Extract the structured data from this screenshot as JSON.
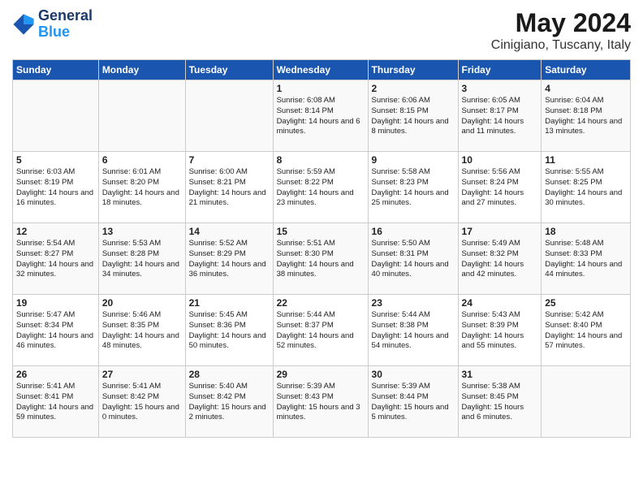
{
  "header": {
    "logo_line1": "General",
    "logo_line2": "Blue",
    "month": "May 2024",
    "location": "Cinigiano, Tuscany, Italy"
  },
  "columns": [
    "Sunday",
    "Monday",
    "Tuesday",
    "Wednesday",
    "Thursday",
    "Friday",
    "Saturday"
  ],
  "weeks": [
    [
      {
        "day": "",
        "sunrise": "",
        "sunset": "",
        "daylight": ""
      },
      {
        "day": "",
        "sunrise": "",
        "sunset": "",
        "daylight": ""
      },
      {
        "day": "",
        "sunrise": "",
        "sunset": "",
        "daylight": ""
      },
      {
        "day": "1",
        "sunrise": "Sunrise: 6:08 AM",
        "sunset": "Sunset: 8:14 PM",
        "daylight": "Daylight: 14 hours and 6 minutes."
      },
      {
        "day": "2",
        "sunrise": "Sunrise: 6:06 AM",
        "sunset": "Sunset: 8:15 PM",
        "daylight": "Daylight: 14 hours and 8 minutes."
      },
      {
        "day": "3",
        "sunrise": "Sunrise: 6:05 AM",
        "sunset": "Sunset: 8:17 PM",
        "daylight": "Daylight: 14 hours and 11 minutes."
      },
      {
        "day": "4",
        "sunrise": "Sunrise: 6:04 AM",
        "sunset": "Sunset: 8:18 PM",
        "daylight": "Daylight: 14 hours and 13 minutes."
      }
    ],
    [
      {
        "day": "5",
        "sunrise": "Sunrise: 6:03 AM",
        "sunset": "Sunset: 8:19 PM",
        "daylight": "Daylight: 14 hours and 16 minutes."
      },
      {
        "day": "6",
        "sunrise": "Sunrise: 6:01 AM",
        "sunset": "Sunset: 8:20 PM",
        "daylight": "Daylight: 14 hours and 18 minutes."
      },
      {
        "day": "7",
        "sunrise": "Sunrise: 6:00 AM",
        "sunset": "Sunset: 8:21 PM",
        "daylight": "Daylight: 14 hours and 21 minutes."
      },
      {
        "day": "8",
        "sunrise": "Sunrise: 5:59 AM",
        "sunset": "Sunset: 8:22 PM",
        "daylight": "Daylight: 14 hours and 23 minutes."
      },
      {
        "day": "9",
        "sunrise": "Sunrise: 5:58 AM",
        "sunset": "Sunset: 8:23 PM",
        "daylight": "Daylight: 14 hours and 25 minutes."
      },
      {
        "day": "10",
        "sunrise": "Sunrise: 5:56 AM",
        "sunset": "Sunset: 8:24 PM",
        "daylight": "Daylight: 14 hours and 27 minutes."
      },
      {
        "day": "11",
        "sunrise": "Sunrise: 5:55 AM",
        "sunset": "Sunset: 8:25 PM",
        "daylight": "Daylight: 14 hours and 30 minutes."
      }
    ],
    [
      {
        "day": "12",
        "sunrise": "Sunrise: 5:54 AM",
        "sunset": "Sunset: 8:27 PM",
        "daylight": "Daylight: 14 hours and 32 minutes."
      },
      {
        "day": "13",
        "sunrise": "Sunrise: 5:53 AM",
        "sunset": "Sunset: 8:28 PM",
        "daylight": "Daylight: 14 hours and 34 minutes."
      },
      {
        "day": "14",
        "sunrise": "Sunrise: 5:52 AM",
        "sunset": "Sunset: 8:29 PM",
        "daylight": "Daylight: 14 hours and 36 minutes."
      },
      {
        "day": "15",
        "sunrise": "Sunrise: 5:51 AM",
        "sunset": "Sunset: 8:30 PM",
        "daylight": "Daylight: 14 hours and 38 minutes."
      },
      {
        "day": "16",
        "sunrise": "Sunrise: 5:50 AM",
        "sunset": "Sunset: 8:31 PM",
        "daylight": "Daylight: 14 hours and 40 minutes."
      },
      {
        "day": "17",
        "sunrise": "Sunrise: 5:49 AM",
        "sunset": "Sunset: 8:32 PM",
        "daylight": "Daylight: 14 hours and 42 minutes."
      },
      {
        "day": "18",
        "sunrise": "Sunrise: 5:48 AM",
        "sunset": "Sunset: 8:33 PM",
        "daylight": "Daylight: 14 hours and 44 minutes."
      }
    ],
    [
      {
        "day": "19",
        "sunrise": "Sunrise: 5:47 AM",
        "sunset": "Sunset: 8:34 PM",
        "daylight": "Daylight: 14 hours and 46 minutes."
      },
      {
        "day": "20",
        "sunrise": "Sunrise: 5:46 AM",
        "sunset": "Sunset: 8:35 PM",
        "daylight": "Daylight: 14 hours and 48 minutes."
      },
      {
        "day": "21",
        "sunrise": "Sunrise: 5:45 AM",
        "sunset": "Sunset: 8:36 PM",
        "daylight": "Daylight: 14 hours and 50 minutes."
      },
      {
        "day": "22",
        "sunrise": "Sunrise: 5:44 AM",
        "sunset": "Sunset: 8:37 PM",
        "daylight": "Daylight: 14 hours and 52 minutes."
      },
      {
        "day": "23",
        "sunrise": "Sunrise: 5:44 AM",
        "sunset": "Sunset: 8:38 PM",
        "daylight": "Daylight: 14 hours and 54 minutes."
      },
      {
        "day": "24",
        "sunrise": "Sunrise: 5:43 AM",
        "sunset": "Sunset: 8:39 PM",
        "daylight": "Daylight: 14 hours and 55 minutes."
      },
      {
        "day": "25",
        "sunrise": "Sunrise: 5:42 AM",
        "sunset": "Sunset: 8:40 PM",
        "daylight": "Daylight: 14 hours and 57 minutes."
      }
    ],
    [
      {
        "day": "26",
        "sunrise": "Sunrise: 5:41 AM",
        "sunset": "Sunset: 8:41 PM",
        "daylight": "Daylight: 14 hours and 59 minutes."
      },
      {
        "day": "27",
        "sunrise": "Sunrise: 5:41 AM",
        "sunset": "Sunset: 8:42 PM",
        "daylight": "Daylight: 15 hours and 0 minutes."
      },
      {
        "day": "28",
        "sunrise": "Sunrise: 5:40 AM",
        "sunset": "Sunset: 8:42 PM",
        "daylight": "Daylight: 15 hours and 2 minutes."
      },
      {
        "day": "29",
        "sunrise": "Sunrise: 5:39 AM",
        "sunset": "Sunset: 8:43 PM",
        "daylight": "Daylight: 15 hours and 3 minutes."
      },
      {
        "day": "30",
        "sunrise": "Sunrise: 5:39 AM",
        "sunset": "Sunset: 8:44 PM",
        "daylight": "Daylight: 15 hours and 5 minutes."
      },
      {
        "day": "31",
        "sunrise": "Sunrise: 5:38 AM",
        "sunset": "Sunset: 8:45 PM",
        "daylight": "Daylight: 15 hours and 6 minutes."
      },
      {
        "day": "",
        "sunrise": "",
        "sunset": "",
        "daylight": ""
      }
    ]
  ]
}
